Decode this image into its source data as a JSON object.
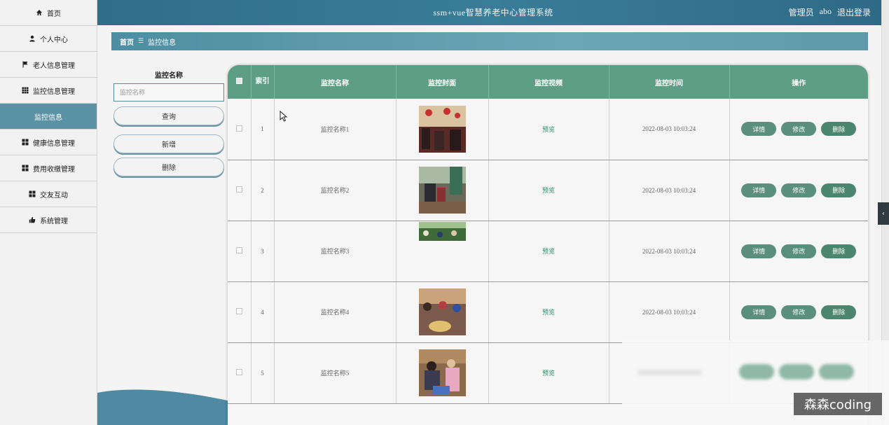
{
  "app": {
    "title": "ssm+vue智慧养老中心管理系统"
  },
  "header": {
    "role": "管理员",
    "username": "abo",
    "logout": "退出登录"
  },
  "sidebar": {
    "items": [
      {
        "label": "首页",
        "icon": "home-icon"
      },
      {
        "label": "个人中心",
        "icon": "user-icon"
      },
      {
        "label": "老人信息管理",
        "icon": "flag-icon"
      },
      {
        "label": "监控信息管理",
        "icon": "grid-icon"
      },
      {
        "label": "监控信息",
        "icon": "",
        "active": true
      },
      {
        "label": "健康信息管理",
        "icon": "apps-icon"
      },
      {
        "label": "费用收缴管理",
        "icon": "apps-icon"
      },
      {
        "label": "交友互动",
        "icon": "apps-icon"
      },
      {
        "label": "系统管理",
        "icon": "thumb-icon"
      }
    ]
  },
  "breadcrumb": {
    "home": "首页",
    "separator_icon": "list-icon",
    "current": "监控信息"
  },
  "search": {
    "label": "监控名称",
    "placeholder": "监控名称",
    "query_button": "查询",
    "add_button": "新增",
    "delete_button": "删除"
  },
  "table": {
    "columns": [
      "索引",
      "监控名称",
      "监控封面",
      "监控视频",
      "监控时间",
      "操作"
    ],
    "rows": [
      {
        "index": "1",
        "name": "监控名称1",
        "video": "预览",
        "time": "2022-08-03 10:03:24"
      },
      {
        "index": "2",
        "name": "监控名称2",
        "video": "预览",
        "time": "2022-08-03 10:03:24"
      },
      {
        "index": "3",
        "name": "监控名称3",
        "video": "预览",
        "time": "2022-08-03 10:03:24"
      },
      {
        "index": "4",
        "name": "监控名称4",
        "video": "预览",
        "time": "2022-08-03 10:03:24"
      },
      {
        "index": "5",
        "name": "监控名称5",
        "video": "预览",
        "time": ""
      }
    ],
    "actions": {
      "detail": "详情",
      "edit": "修改",
      "delete": "删除"
    }
  },
  "watermark": "森森coding",
  "colors": {
    "header": "#2f6e8a",
    "active": "#5b92a5",
    "table_head": "#5f9e86",
    "action": "#5a8f7d"
  }
}
